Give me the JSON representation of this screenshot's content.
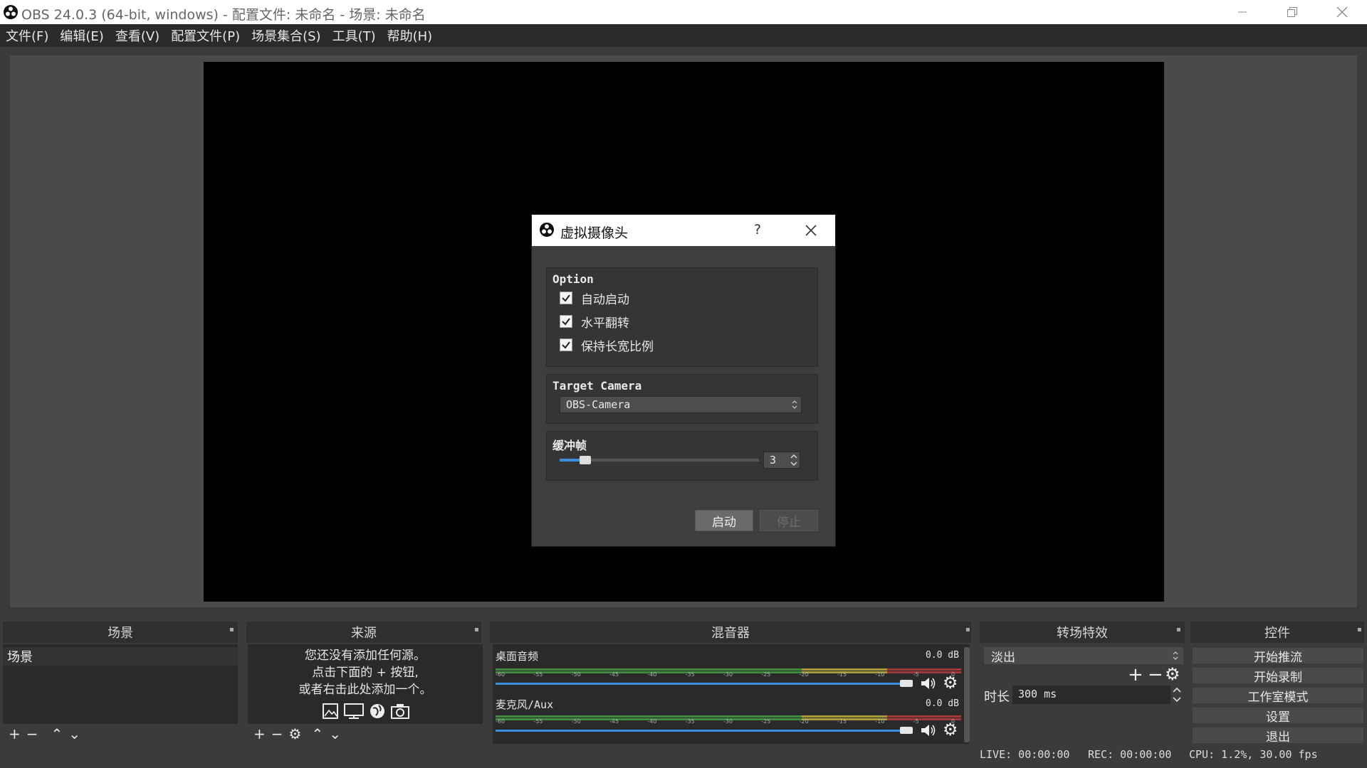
{
  "window": {
    "title": "OBS 24.0.3 (64-bit, windows) - 配置文件: 未命名 - 场景: 未命名"
  },
  "menu": [
    "文件(F)",
    "编辑(E)",
    "查看(V)",
    "配置文件(P)",
    "场景集合(S)",
    "工具(T)",
    "帮助(H)"
  ],
  "dialog": {
    "title": "虚拟摄像头",
    "help": "?",
    "option_group": "Option",
    "checkboxes": [
      {
        "label": "自动启动",
        "checked": true
      },
      {
        "label": "水平翻转",
        "checked": true
      },
      {
        "label": "保持长宽比例",
        "checked": true
      }
    ],
    "target_group": "Target Camera",
    "target_value": "OBS-Camera",
    "buffer_group": "缓冲帧",
    "buffer_value": "3",
    "start_label": "启动",
    "stop_label": "停止"
  },
  "docks": {
    "scenes": {
      "title": "场景",
      "items": [
        "场景"
      ]
    },
    "sources": {
      "title": "来源",
      "empty_lines": [
        "您还没有添加任何源。",
        "点击下面的 + 按钮,",
        "或者右击此处添加一个。"
      ]
    },
    "mixer": {
      "title": "混音器",
      "channels": [
        {
          "name": "桌面音频",
          "db": "0.0 dB"
        },
        {
          "name": "麦克风/Aux",
          "db": "0.0 dB"
        }
      ],
      "ticks": [
        "-60",
        "-55",
        "-50",
        "-45",
        "-40",
        "-35",
        "-30",
        "-25",
        "-20",
        "-15",
        "-10",
        "-5",
        "0"
      ]
    },
    "transitions": {
      "title": "转场特效",
      "selected": "淡出",
      "duration_label": "时长",
      "duration_value": "300 ms"
    },
    "controls": {
      "title": "控件",
      "buttons": [
        "开始推流",
        "开始录制",
        "工作室模式",
        "设置",
        "退出"
      ]
    }
  },
  "status": {
    "live": "LIVE: 00:00:00",
    "rec": "REC: 00:00:00",
    "cpu": "CPU: 1.2%, 30.00 fps"
  },
  "colors": {
    "accent": "#3a8ee6",
    "meter_green": "#4caf50",
    "meter_yellow": "#c9b24a",
    "meter_red": "#c04040"
  }
}
